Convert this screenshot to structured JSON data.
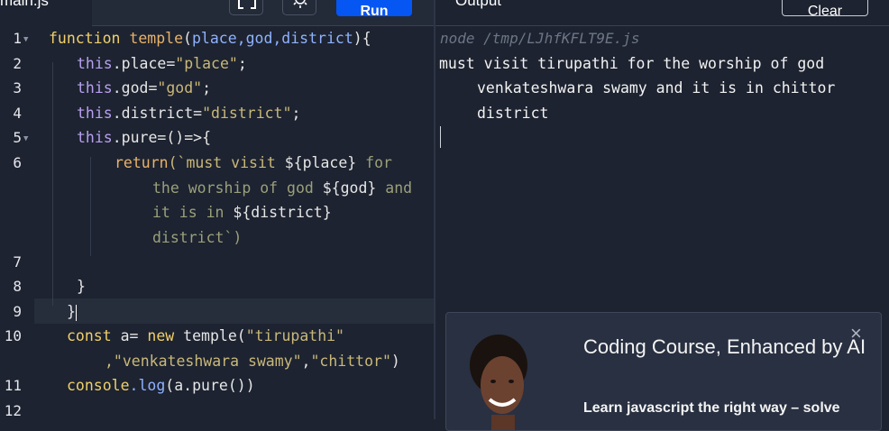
{
  "tabs": {
    "file_tab": "main.js"
  },
  "toolbar": {
    "run_label": "Run",
    "fullscreen_icon": "fullscreen-icon",
    "theme_icon": "sun-icon"
  },
  "output": {
    "title": "Output",
    "clear_label": "Clear",
    "command": "node /tmp/LJhfKFLT9E.js",
    "lines": [
      "must visit tirupathi for the worship of god",
      "venkateshwara swamy and it is in chittor",
      "district"
    ]
  },
  "editor": {
    "line_numbers": [
      "1",
      "2",
      "3",
      "4",
      "5",
      "6",
      "7",
      "8",
      "9",
      "10",
      "11",
      "12"
    ],
    "code": {
      "l1": {
        "kw": "function",
        "name": "temple",
        "open": "(",
        "params": "place,god,district",
        "close": "){"
      },
      "l2": {
        "this": "this",
        "prop": ".place=",
        "str": "\"place\"",
        "end": ";"
      },
      "l3": {
        "this": "this",
        "prop": ".god=",
        "str": "\"god\"",
        "end": ";"
      },
      "l4": {
        "this": "this",
        "prop": ".district=",
        "str": "\"district\"",
        "end": ";"
      },
      "l5": {
        "this": "this",
        "prop": ".pure=",
        "rest": "()=>{"
      },
      "l6a": {
        "ret": "return",
        "open": "(`must visit ",
        "v1": "${place}",
        "t1": " for"
      },
      "l6b": {
        "t": "the worship of god ",
        "v": "${god}",
        "t2": " and"
      },
      "l6c": {
        "t": "it is in ",
        "v": "${district}"
      },
      "l6d": {
        "t": "district`)"
      },
      "l8": "}",
      "l9": "}",
      "l10a": {
        "kw": "const",
        "var": " a",
        "eq": "= ",
        "new": "new",
        "call": " temple(",
        "s1": "\"tirupathi\""
      },
      "l10b": {
        "s2": ",\"venkateshwara swamy\"",
        "comma": ",",
        "s3": "\"chittor\"",
        "end": ")"
      },
      "l11": {
        "obj": "console",
        "m": ".log",
        "rest": "(a.pure())"
      }
    }
  },
  "ad": {
    "title": "Coding Course, Enhanced by AI",
    "text": "Learn javascript the right way – solve",
    "close_icon": "close-icon"
  },
  "colors": {
    "run_button": "#0556f3",
    "background": "#1d2330"
  }
}
